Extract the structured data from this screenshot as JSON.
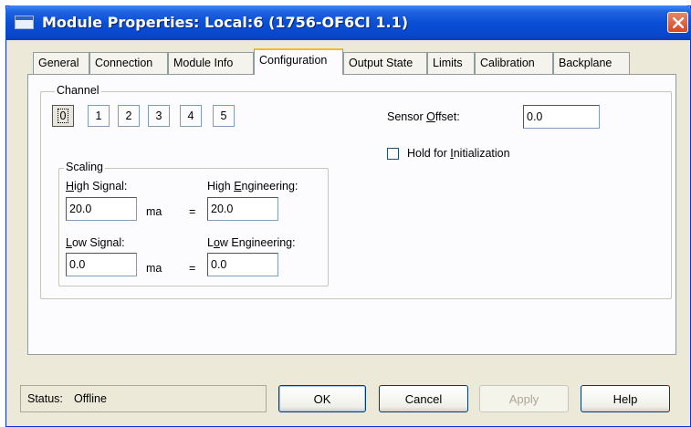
{
  "window": {
    "title": "Module Properties: Local:6 (1756-OF6CI 1.1)"
  },
  "tabs": [
    {
      "label": "General",
      "active": false
    },
    {
      "label": "Connection",
      "active": false
    },
    {
      "label": "Module Info",
      "active": false
    },
    {
      "label": "Configuration",
      "active": true
    },
    {
      "label": "Output State",
      "active": false
    },
    {
      "label": "Limits",
      "active": false
    },
    {
      "label": "Calibration",
      "active": false
    },
    {
      "label": "Backplane",
      "active": false
    }
  ],
  "channel": {
    "group_label": "Channel",
    "buttons": [
      "0",
      "1",
      "2",
      "3",
      "4",
      "5"
    ],
    "selected": "0"
  },
  "sensor_offset": {
    "label_pre": "Sensor ",
    "label_mnemonic": "O",
    "label_post": "ffset:",
    "value": "0.0"
  },
  "hold_init": {
    "label_pre": "Hold for ",
    "label_mnemonic": "I",
    "label_post": "nitialization",
    "checked": false
  },
  "scaling": {
    "group_label": "Scaling",
    "high_signal": {
      "label_mnemonic": "H",
      "label_post": "igh Signal:",
      "value": "20.0",
      "unit": "ma"
    },
    "high_eng": {
      "label_pre": "High ",
      "label_mnemonic": "E",
      "label_post": "ngineering:",
      "value": "20.0"
    },
    "low_signal": {
      "label_mnemonic": "L",
      "label_post": "ow Signal:",
      "value": "0.0",
      "unit": "ma"
    },
    "low_eng": {
      "label_pre": "L",
      "label_mnemonic": "o",
      "label_post": "w Engineering:",
      "value": "0.0"
    },
    "equals": "="
  },
  "status": {
    "label": "Status:",
    "value": "Offline"
  },
  "buttons": {
    "ok": "OK",
    "cancel": "Cancel",
    "apply": "Apply",
    "help": "Help"
  }
}
